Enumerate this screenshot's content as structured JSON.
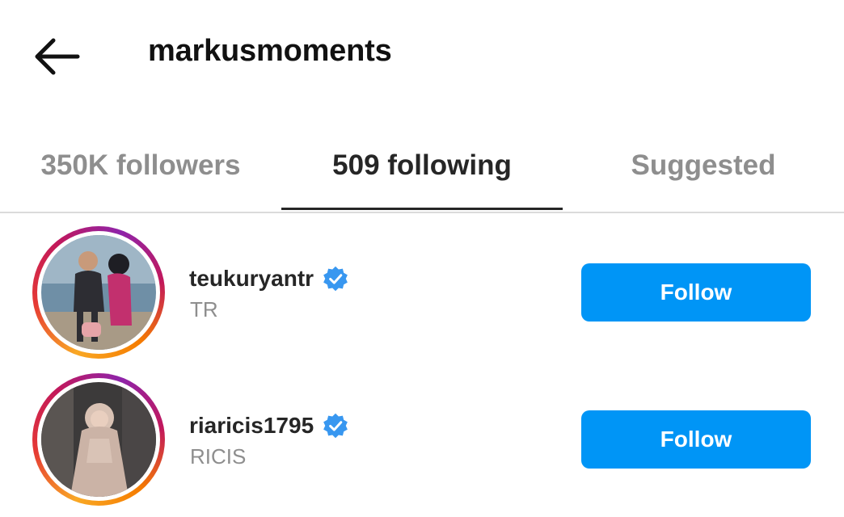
{
  "header": {
    "title": "markusmoments",
    "back_icon": "arrow-left-icon"
  },
  "tabs": [
    {
      "label": "350K followers",
      "active": false
    },
    {
      "label": "509 following",
      "active": true
    },
    {
      "label": "Suggested",
      "active": false
    }
  ],
  "users": [
    {
      "username": "teukuryantr",
      "full_name": "TR",
      "verified": true,
      "button": "Follow"
    },
    {
      "username": "riaricis1795",
      "full_name": "RICIS",
      "verified": true,
      "button": "Follow"
    }
  ],
  "colors": {
    "accent": "#0095f6",
    "text_primary": "#262626",
    "text_secondary": "#8e8e8e",
    "divider": "#dbdbdb",
    "verified": "#3897f0"
  }
}
